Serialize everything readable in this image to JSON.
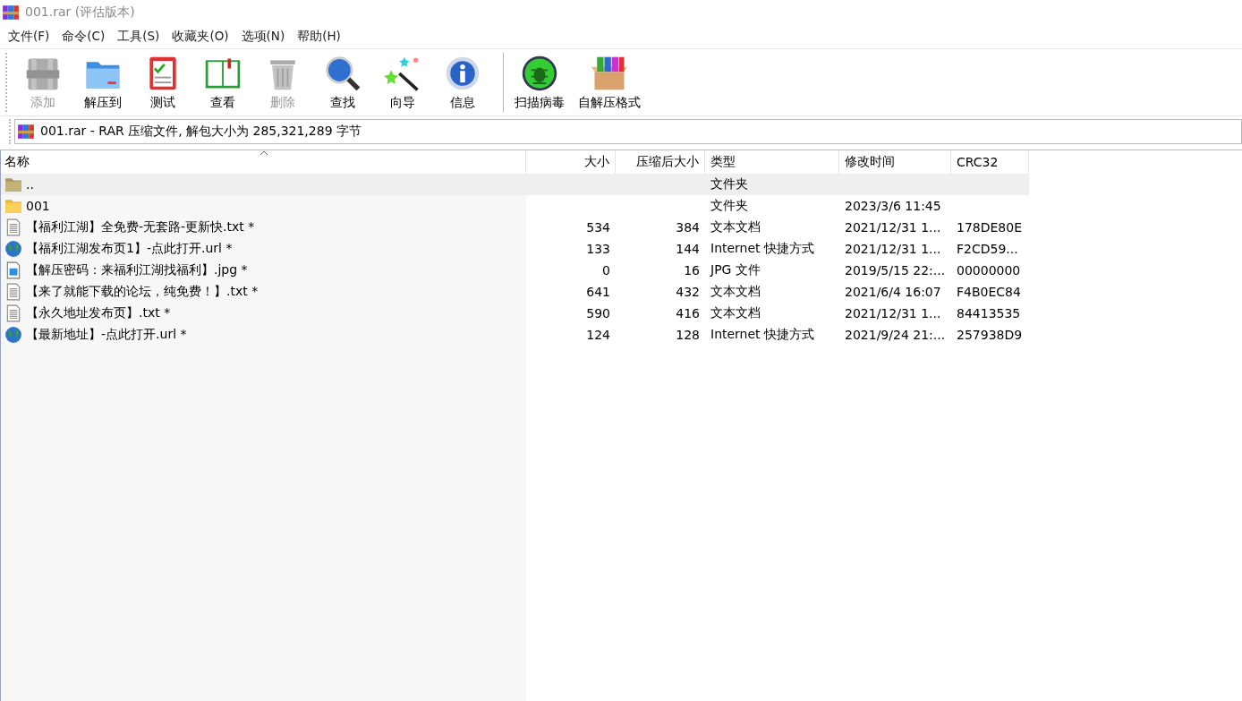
{
  "window": {
    "title": "001.rar (评估版本)"
  },
  "menu": [
    "文件(F)",
    "命令(C)",
    "工具(S)",
    "收藏夹(O)",
    "选项(N)",
    "帮助(H)"
  ],
  "toolbar": {
    "groups": [
      {
        "buttons": [
          {
            "kind": "add",
            "label": "添加",
            "disabled": true
          },
          {
            "kind": "extract",
            "label": "解压到",
            "disabled": false
          },
          {
            "kind": "test",
            "label": "测试",
            "disabled": false
          },
          {
            "kind": "view",
            "label": "查看",
            "disabled": false
          },
          {
            "kind": "delete",
            "label": "删除",
            "disabled": true
          },
          {
            "kind": "find",
            "label": "查找",
            "disabled": false
          },
          {
            "kind": "wizard",
            "label": "向导",
            "disabled": false
          },
          {
            "kind": "info",
            "label": "信息",
            "disabled": false
          }
        ]
      },
      {
        "buttons": [
          {
            "kind": "virus",
            "label": "扫描病毒",
            "disabled": false
          },
          {
            "kind": "sfx",
            "label": "自解压格式",
            "disabled": false
          }
        ]
      }
    ]
  },
  "address": {
    "text": "001.rar - RAR 压缩文件, 解包大小为 285,321,289 字节"
  },
  "table": {
    "columns": [
      "名称",
      "大小",
      "压缩后大小",
      "类型",
      "修改时间",
      "CRC32"
    ],
    "rows": [
      {
        "kind": "parent",
        "selected": true,
        "name": "..",
        "size": "",
        "packed": "",
        "type": "文件夹",
        "modified": "",
        "crc": ""
      },
      {
        "kind": "folder",
        "selected": false,
        "name": "001",
        "size": "",
        "packed": "",
        "type": "文件夹",
        "modified": "2023/3/6 11:45",
        "crc": ""
      },
      {
        "kind": "text",
        "selected": false,
        "name": "【福利江湖】全免费-无套路-更新快.txt *",
        "size": "534",
        "packed": "384",
        "type": "文本文档",
        "modified": "2021/12/31 1...",
        "crc": "178DE80E"
      },
      {
        "kind": "url",
        "selected": false,
        "name": "【福利江湖发布页1】-点此打开.url *",
        "size": "133",
        "packed": "144",
        "type": "Internet 快捷方式",
        "modified": "2021/12/31 1...",
        "crc": "F2CD59..."
      },
      {
        "kind": "image",
        "selected": false,
        "name": "【解压密码：来福利江湖找福利】.jpg *",
        "size": "0",
        "packed": "16",
        "type": "JPG 文件",
        "modified": "2019/5/15 22:...",
        "crc": "00000000"
      },
      {
        "kind": "text",
        "selected": false,
        "name": "【来了就能下载的论坛，纯免费！】.txt *",
        "size": "641",
        "packed": "432",
        "type": "文本文档",
        "modified": "2021/6/4 16:07",
        "crc": "F4B0EC84"
      },
      {
        "kind": "text",
        "selected": false,
        "name": "【永久地址发布页】.txt *",
        "size": "590",
        "packed": "416",
        "type": "文本文档",
        "modified": "2021/12/31 1...",
        "crc": "84413535"
      },
      {
        "kind": "url",
        "selected": false,
        "name": "【最新地址】-点此打开.url *",
        "size": "124",
        "packed": "128",
        "type": "Internet 快捷方式",
        "modified": "2021/9/24 21:...",
        "crc": "257938D9"
      }
    ]
  }
}
